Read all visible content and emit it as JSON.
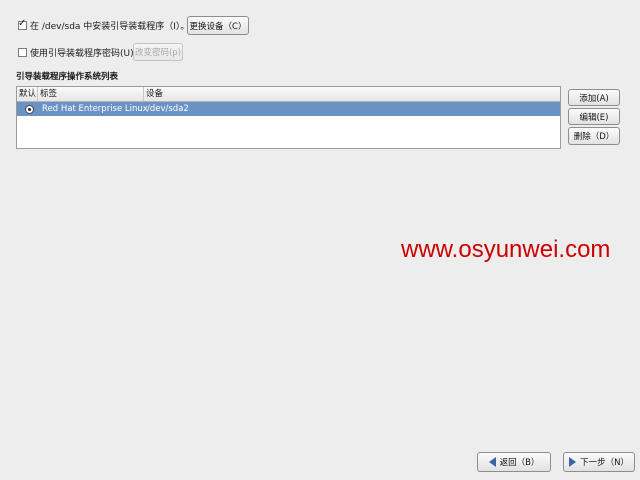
{
  "install_option": {
    "checked": true,
    "label": "在 /dev/sda 中安装引导装载程序（I）。",
    "change_device_button": "更换设备（C）"
  },
  "password_option": {
    "checked": false,
    "label": "使用引导装载程序密码(U)",
    "change_password_button": "改变密码(p)"
  },
  "os_list": {
    "title": "引导装载程序操作系统列表",
    "columns": [
      "默认",
      "标签",
      "设备"
    ],
    "rows": [
      {
        "default": true,
        "label": "Red Hat Enterprise Linux",
        "device": "/dev/sda2"
      }
    ]
  },
  "side_buttons": {
    "add": "添加(A)",
    "edit": "编辑(E)",
    "delete": "删除（D）"
  },
  "watermark": "www.osyunwei.com",
  "colors": {
    "selection": "#6b92c5",
    "watermark": "#cc0000"
  },
  "nav": {
    "back": "返回（B）",
    "next": "下一步（N）"
  }
}
